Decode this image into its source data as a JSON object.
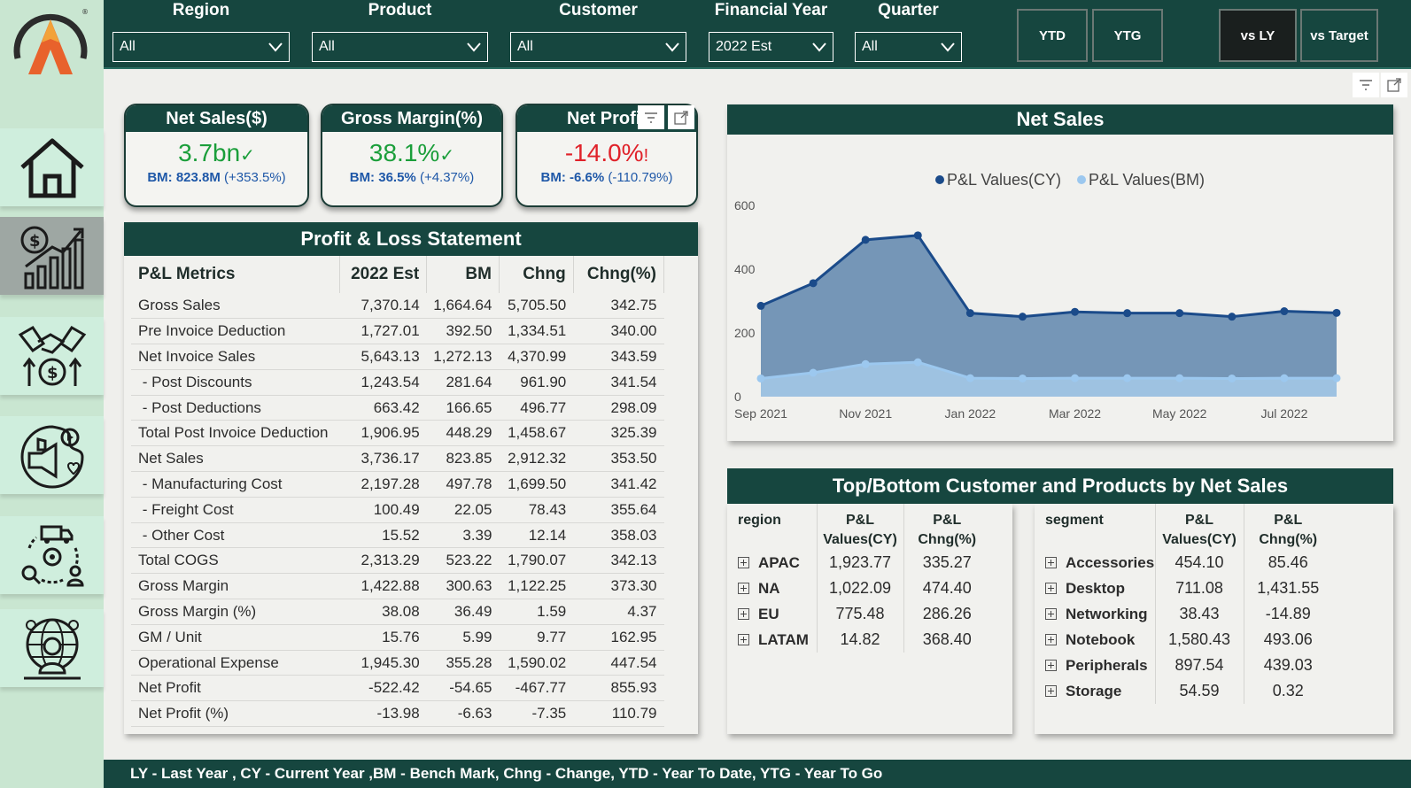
{
  "sidebar": {
    "logo": "brand-logo",
    "items": [
      {
        "name": "home-icon",
        "active": false
      },
      {
        "name": "finance-growth-icon",
        "active": true
      },
      {
        "name": "handshake-money-icon",
        "active": false
      },
      {
        "name": "marketing-icon",
        "active": false
      },
      {
        "name": "supply-chain-icon",
        "active": false
      },
      {
        "name": "global-user-icon",
        "active": false
      }
    ]
  },
  "filters": {
    "region": {
      "label": "Region",
      "value": "All"
    },
    "product": {
      "label": "Product",
      "value": "All"
    },
    "customer": {
      "label": "Customer",
      "value": "All"
    },
    "financial_year": {
      "label": "Financial Year",
      "value": "2022 Est"
    },
    "quarter": {
      "label": "Quarter",
      "value": "All"
    }
  },
  "buttons": {
    "ytd": "YTD",
    "ytg": "YTG",
    "vs_ly": "vs LY",
    "vs_target": "vs Target"
  },
  "kpis": {
    "net_sales": {
      "title": "Net Sales($)",
      "value": "3.7bn",
      "indicator": "✓",
      "bm_label": "BM:",
      "bm_value": "823.8M",
      "bm_change": "(+353.5%)",
      "color": "#1a9e3a"
    },
    "gross_margin": {
      "title": "Gross Margin(%)",
      "value": "38.1%",
      "indicator": "✓",
      "bm_label": "BM:",
      "bm_value": "36.5%",
      "bm_change": "(+4.37%)",
      "color": "#1a9e3a"
    },
    "net_profit": {
      "title": "Net Profit",
      "value": "-14.0%",
      "indicator": "!",
      "bm_label": "BM:",
      "bm_value": "-6.6%",
      "bm_change": "(-110.79%)",
      "color": "#e0222a"
    }
  },
  "pl": {
    "title": "Profit & Loss Statement",
    "headers": [
      "P&L Metrics",
      "2022 Est",
      "BM",
      "Chng",
      "Chng(%)"
    ],
    "rows": [
      [
        "Gross Sales",
        "7,370.14",
        "1,664.64",
        "5,705.50",
        "342.75"
      ],
      [
        "Pre Invoice Deduction",
        "1,727.01",
        "392.50",
        "1,334.51",
        "340.00"
      ],
      [
        "Net Invoice Sales",
        "5,643.13",
        "1,272.13",
        "4,370.99",
        "343.59"
      ],
      [
        " - Post Discounts",
        "1,243.54",
        "281.64",
        "961.90",
        "341.54"
      ],
      [
        " - Post Deductions",
        "663.42",
        "166.65",
        "496.77",
        "298.09"
      ],
      [
        "Total Post Invoice Deduction",
        "1,906.95",
        "448.29",
        "1,458.67",
        "325.39"
      ],
      [
        "Net Sales",
        "3,736.17",
        "823.85",
        "2,912.32",
        "353.50"
      ],
      [
        " - Manufacturing Cost",
        "2,197.28",
        "497.78",
        "1,699.50",
        "341.42"
      ],
      [
        " - Freight Cost",
        "100.49",
        "22.05",
        "78.43",
        "355.64"
      ],
      [
        " - Other Cost",
        "15.52",
        "3.39",
        "12.14",
        "358.03"
      ],
      [
        "Total COGS",
        "2,313.29",
        "523.22",
        "1,790.07",
        "342.13"
      ],
      [
        "Gross Margin",
        "1,422.88",
        "300.63",
        "1,122.25",
        "373.30"
      ],
      [
        "Gross Margin (%)",
        "38.08",
        "36.49",
        "1.59",
        "4.37"
      ],
      [
        "GM / Unit",
        "15.76",
        "5.99",
        "9.77",
        "162.95"
      ],
      [
        "Operational Expense",
        "1,945.30",
        "355.28",
        "1,590.02",
        "447.54"
      ],
      [
        "Net Profit",
        "-522.42",
        "-54.65",
        "-467.77",
        "855.93"
      ],
      [
        "Net Profit (%)",
        "-13.98",
        "-6.63",
        "-7.35",
        "110.79"
      ]
    ]
  },
  "chart_data": {
    "type": "area",
    "title": "Net Sales",
    "x": [
      "Sep 2021",
      "Oct 2021",
      "Nov 2021",
      "Dec 2021",
      "Jan 2022",
      "Feb 2022",
      "Mar 2022",
      "Apr 2022",
      "May 2022",
      "Jun 2022",
      "Jul 2022",
      "Aug 2022"
    ],
    "x_tick_labels": [
      "Sep 2021",
      "Nov 2021",
      "Jan 2022",
      "Mar 2022",
      "May 2022",
      "Jul 2022"
    ],
    "series": [
      {
        "name": "P&L Values(CY)",
        "color": "#1b4b8a",
        "values": [
          285,
          356,
          492,
          506,
          262,
          251,
          266,
          262,
          262,
          251,
          268,
          263
        ]
      },
      {
        "name": "P&L Values(BM)",
        "color": "#9cc8ef",
        "values": [
          57,
          75,
          102,
          108,
          58,
          57,
          58,
          58,
          58,
          57,
          58,
          58
        ]
      }
    ],
    "yticks": [
      0,
      200,
      400,
      600
    ],
    "ylim": [
      0,
      600
    ],
    "legend": "top-center"
  },
  "topbottom": {
    "title": "Top/Bottom Customer and Products by Net Sales",
    "region_headers": [
      "region",
      "P&L Values(CY)",
      "P&L Chng(%)"
    ],
    "regions": [
      [
        "APAC",
        "1,923.77",
        "335.27"
      ],
      [
        "NA",
        "1,022.09",
        "474.40"
      ],
      [
        "EU",
        "775.48",
        "286.26"
      ],
      [
        "LATAM",
        "14.82",
        "368.40"
      ]
    ],
    "segment_headers": [
      "segment",
      "P&L Values(CY)",
      "P&L Chng(%)"
    ],
    "segments": [
      [
        "Accessories",
        "454.10",
        "85.46"
      ],
      [
        "Desktop",
        "711.08",
        "1,431.55"
      ],
      [
        "Networking",
        "38.43",
        "-14.89"
      ],
      [
        "Notebook",
        "1,580.43",
        "493.06"
      ],
      [
        "Peripherals",
        "897.54",
        "439.03"
      ],
      [
        "Storage",
        "54.59",
        "0.32"
      ]
    ]
  },
  "footer": "LY - Last Year , CY - Current Year ,BM - Bench Mark, Chng - Change, YTD - Year To Date, YTG - Year To Go"
}
